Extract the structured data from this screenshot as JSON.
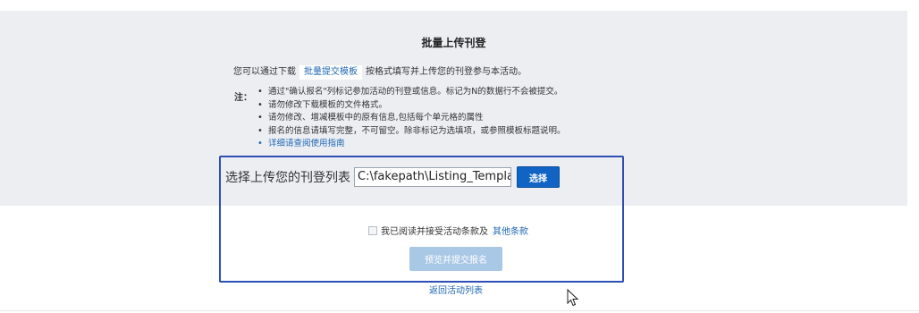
{
  "page": {
    "title": "批量上传刊登",
    "intro_prefix": "您可以通过下载",
    "template_link": "批量提交模板",
    "intro_suffix": "按格式填写并上传您的刊登参与本活动。",
    "notes_label": "注：",
    "notes": [
      "通过\"确认报名\"列标记参加活动的刊登或信息。标记为N的数据行不会被提交。",
      "请勿修改下载模板的文件格式。",
      "请勿修改、增减模板中的原有信息,包括每个单元格的属性",
      "报名的信息请填写完整，不可留空。除非标记为选填项，或参照模板标题说明。",
      "详细请查阅使用指南"
    ]
  },
  "upload": {
    "label": "选择上传您的刊登列表",
    "file_value": "C:\\fakepath\\Listing_Templat",
    "choose_button": "选择"
  },
  "agreement": {
    "text": "我已阅读并接受活动条款及",
    "terms_link": "其他条款",
    "checked": false
  },
  "submit_button": "预览并提交报名",
  "back_link": "返回活动列表",
  "colors": {
    "panel_bg": "#eceef2",
    "primary_button": "#1264c4",
    "disabled_button": "#a9c8e6",
    "link": "#1f66b3",
    "highlight_border": "#2c4eb5"
  },
  "icons": {
    "cursor": "mouse-pointer-icon"
  }
}
